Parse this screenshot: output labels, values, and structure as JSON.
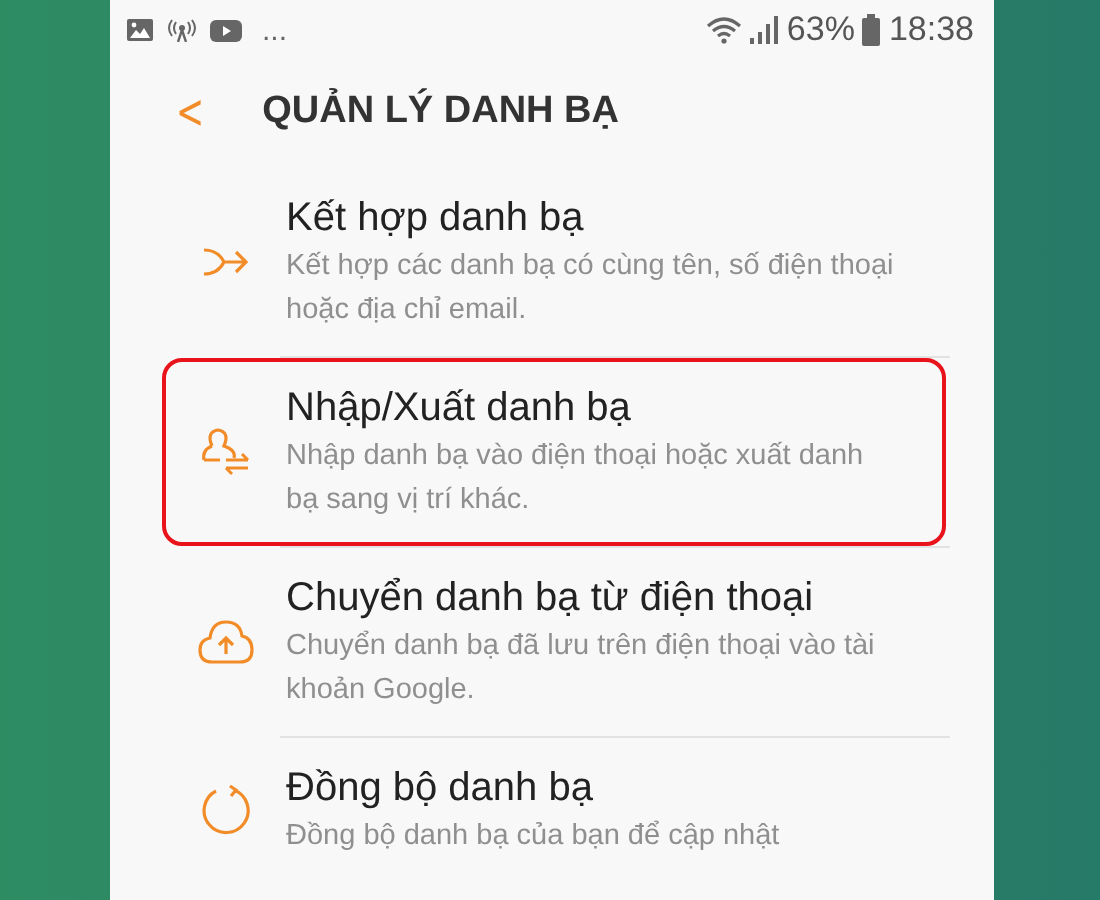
{
  "status_bar": {
    "overflow": "...",
    "battery_text": "63%",
    "time": "18:38"
  },
  "header": {
    "back": "<",
    "title": "QUẢN LÝ DANH BẠ"
  },
  "items": [
    {
      "kind": "merge",
      "title": "Kết hợp danh bạ",
      "subtitle": "Kết hợp các danh bạ có cùng tên, số điện thoại hoặc địa chỉ email.",
      "highlighted": false
    },
    {
      "kind": "import-export",
      "title": "Nhập/Xuất danh bạ",
      "subtitle": "Nhập danh bạ vào điện thoại hoặc xuất danh bạ sang vị trí khác.",
      "highlighted": true
    },
    {
      "kind": "cloud-upload",
      "title": "Chuyển danh bạ từ điện thoại",
      "subtitle": "Chuyển danh bạ đã lưu trên điện thoại vào tài khoản Google.",
      "highlighted": false
    },
    {
      "kind": "sync",
      "title": "Đồng bộ danh bạ",
      "subtitle": "Đồng bộ danh bạ của bạn để cập nhật",
      "highlighted": false
    }
  ]
}
